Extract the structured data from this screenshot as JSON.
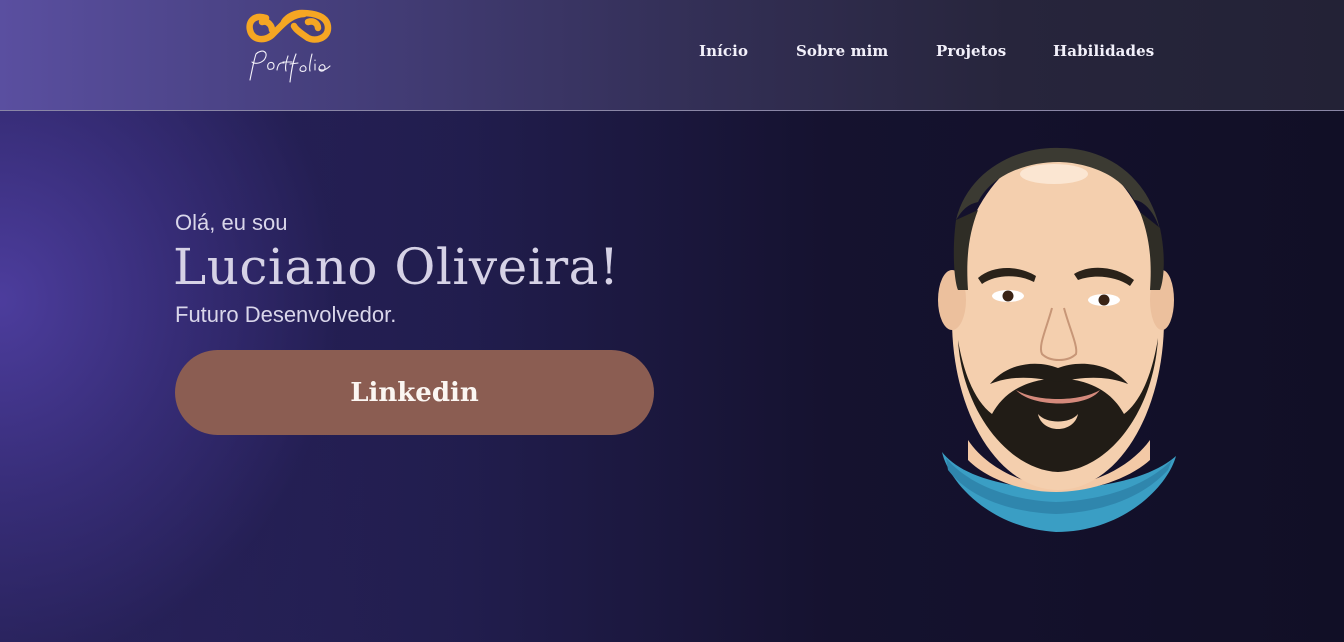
{
  "header": {
    "logo": {
      "icon": "infinity-logo-icon",
      "script_text": "Portfolio",
      "color": "#f5a623"
    },
    "nav": [
      {
        "label": "Início"
      },
      {
        "label": "Sobre mim"
      },
      {
        "label": "Projetos"
      },
      {
        "label": "Habilidades"
      }
    ]
  },
  "hero": {
    "greeting": "Olá, eu sou",
    "name": "Luciano Oliveira!",
    "role": "Futuro Desenvolvedor.",
    "button_label": "Linkedin",
    "button_color": "#8b5d52",
    "portrait": "cartoon-portrait-image"
  }
}
